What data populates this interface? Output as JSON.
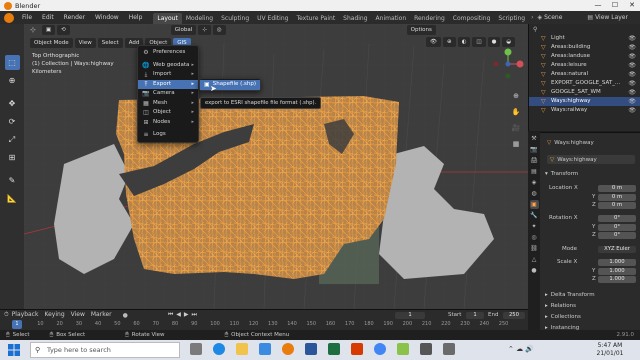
{
  "window": {
    "app_title": "Blender",
    "controls": [
      "—",
      "☐",
      "✕"
    ]
  },
  "menubar": {
    "items": [
      "File",
      "Edit",
      "Render",
      "Window",
      "Help"
    ],
    "workspaces": [
      "Layout",
      "Modeling",
      "Sculpting",
      "UV Editing",
      "Texture Paint",
      "Shading",
      "Animation",
      "Rendering",
      "Compositing",
      "Scripting"
    ],
    "active_workspace": "Layout",
    "scene": "Scene",
    "view_layer": "View Layer"
  },
  "viewport_header": {
    "mode": "Object Mode",
    "menus": [
      "View",
      "Select",
      "Add",
      "Object",
      "GIS"
    ],
    "active_menu": "GIS",
    "orientation": "Global",
    "options": "Options"
  },
  "viewport_info": {
    "line1": "Top Orthographic",
    "line2": "(1) Collection | Ways:highway",
    "line3": "Kilometers"
  },
  "gis_menu": {
    "items": [
      {
        "label": "Preferences",
        "icon": "⚙",
        "submenu": false
      },
      {
        "label": "Web geodata",
        "icon": "🌐",
        "submenu": true
      },
      {
        "label": "Import",
        "icon": "⤓",
        "submenu": true
      },
      {
        "label": "Export",
        "icon": "⤒",
        "submenu": true
      },
      {
        "label": "Camera",
        "icon": "📷",
        "submenu": true
      },
      {
        "label": "Mesh",
        "icon": "▦",
        "submenu": true
      },
      {
        "label": "Object",
        "icon": "◫",
        "submenu": true
      },
      {
        "label": "Nodes",
        "icon": "⊞",
        "submenu": true
      },
      {
        "label": "Logs",
        "icon": "≡",
        "submenu": false
      }
    ],
    "highlighted": "Export"
  },
  "export_submenu": {
    "item": "Shapefile (.shp)",
    "tooltip": "export to ESRI shapefile file format (.shp)."
  },
  "outliner": {
    "items": [
      {
        "label": "Light",
        "selected": false
      },
      {
        "label": "Areas:building",
        "selected": false
      },
      {
        "label": "Areas:landuse",
        "selected": false
      },
      {
        "label": "Areas:leisure",
        "selected": false
      },
      {
        "label": "Areas:natural",
        "selected": false
      },
      {
        "label": "EXPORT_GOOGLE_SAT_...",
        "selected": false
      },
      {
        "label": "GOOGLE_SAT_WM",
        "selected": false
      },
      {
        "label": "Ways:highway",
        "selected": true
      },
      {
        "label": "Ways:railway",
        "selected": false
      }
    ]
  },
  "properties": {
    "object_name": "Ways:highway",
    "data_name": "Ways:highway",
    "transform_title": "Transform",
    "location_label": "Location X",
    "location": {
      "x": "0 m",
      "y": "0 m",
      "z": "0 m"
    },
    "rotation_label": "Rotation X",
    "rotation": {
      "x": "0°",
      "y": "0°",
      "z": "0°"
    },
    "mode_label": "Mode",
    "mode_value": "XYZ Euler",
    "scale_label": "Scale X",
    "scale": {
      "x": "1.000",
      "y": "1.000",
      "z": "1.000"
    },
    "axis_y": "Y",
    "axis_z": "Z",
    "sections": [
      "Delta Transform",
      "Relations",
      "Collections",
      "Instancing"
    ]
  },
  "timeline": {
    "menus": [
      "Playback",
      "Keying",
      "View",
      "Marker"
    ],
    "current_frame": "1",
    "start_label": "Start",
    "start": "1",
    "end_label": "End",
    "end": "250",
    "ticks": [
      "0",
      "10",
      "20",
      "30",
      "40",
      "50",
      "60",
      "70",
      "80",
      "90",
      "100",
      "110",
      "120",
      "130",
      "140",
      "150",
      "160",
      "170",
      "180",
      "190",
      "200",
      "210",
      "220",
      "230",
      "240",
      "250"
    ]
  },
  "statusbar": {
    "select": "Select",
    "box_select": "Box Select",
    "rotate_view": "Rotate View",
    "context_menu": "Object Context Menu",
    "version": "2.91.0"
  },
  "taskbar": {
    "search_placeholder": "Type here to search",
    "time": "5:47 AM",
    "date": "21/01/01"
  },
  "colors": {
    "accent": "#4772b3",
    "highway": "#e89a3c",
    "land": "#b3b3b3",
    "viewport_bg": "#3d3d3d"
  }
}
